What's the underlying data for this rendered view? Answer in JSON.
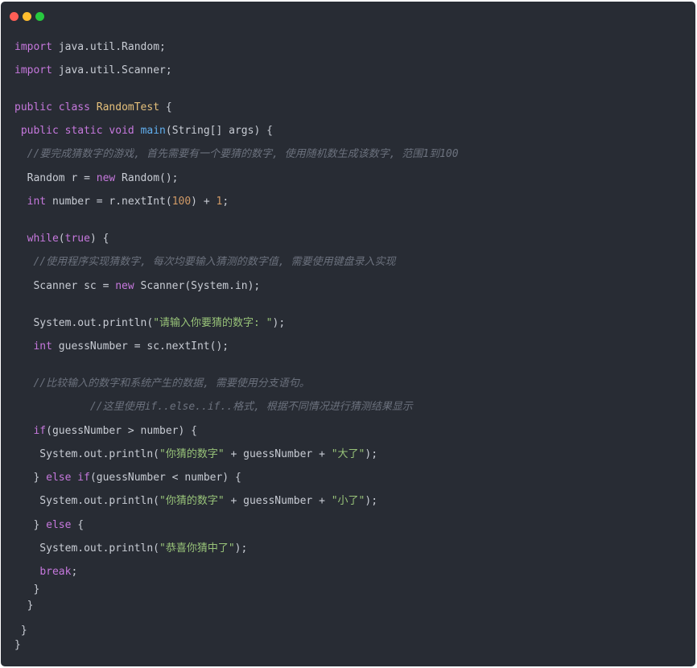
{
  "colors": {
    "background": "#282c34",
    "text": "#c8ccd4",
    "keyword": "#c678dd",
    "class": "#e5c07b",
    "function": "#61afef",
    "string": "#98c379",
    "number": "#d19a66",
    "comment": "#6b717d",
    "close_dot": "#ff5f56",
    "minimize_dot": "#ffbd2e",
    "maximize_dot": "#27c93f"
  },
  "window_controls": [
    {
      "name": "close",
      "color": "#ff5f56"
    },
    {
      "name": "minimize",
      "color": "#ffbd2e"
    },
    {
      "name": "maximize",
      "color": "#27c93f"
    }
  ],
  "code": [
    [
      {
        "t": "import",
        "c": "keyword"
      },
      {
        "t": " java.util.Random;",
        "c": "text"
      }
    ],
    [
      {
        "t": "import",
        "c": "keyword"
      },
      {
        "t": " java.util.Scanner;",
        "c": "text"
      }
    ],
    [
      {
        "t": "public",
        "c": "keyword"
      },
      {
        "t": " ",
        "c": "text"
      },
      {
        "t": "class",
        "c": "keyword"
      },
      {
        "t": " ",
        "c": "text"
      },
      {
        "t": "RandomTest",
        "c": "class"
      },
      {
        "t": " {",
        "c": "text"
      }
    ],
    [
      {
        "t": " ",
        "c": "text"
      },
      {
        "t": "public",
        "c": "keyword"
      },
      {
        "t": " ",
        "c": "text"
      },
      {
        "t": "static",
        "c": "keyword"
      },
      {
        "t": " ",
        "c": "text"
      },
      {
        "t": "void",
        "c": "keyword"
      },
      {
        "t": " ",
        "c": "text"
      },
      {
        "t": "main",
        "c": "function"
      },
      {
        "t": "(String[] args) {",
        "c": "text"
      }
    ],
    [
      {
        "t": "  //要完成猜数字的游戏, 首先需要有一个要猜的数字, 使用随机数生成该数字, 范围1到100",
        "c": "comment"
      }
    ],
    [
      {
        "t": "  Random r = ",
        "c": "text"
      },
      {
        "t": "new",
        "c": "keyword"
      },
      {
        "t": " Random();",
        "c": "text"
      }
    ],
    [
      {
        "t": "  ",
        "c": "text"
      },
      {
        "t": "int",
        "c": "keyword"
      },
      {
        "t": " number = r.nextInt(",
        "c": "text"
      },
      {
        "t": "100",
        "c": "number"
      },
      {
        "t": ") + ",
        "c": "text"
      },
      {
        "t": "1",
        "c": "number"
      },
      {
        "t": ";",
        "c": "text"
      }
    ],
    [
      {
        "t": "  ",
        "c": "text"
      },
      {
        "t": "while",
        "c": "keyword"
      },
      {
        "t": "(",
        "c": "text"
      },
      {
        "t": "true",
        "c": "keyword"
      },
      {
        "t": ") {",
        "c": "text"
      }
    ],
    [
      {
        "t": "   //使用程序实现猜数字, 每次均要输入猜测的数字值, 需要使用键盘录入实现",
        "c": "comment"
      }
    ],
    [
      {
        "t": "   Scanner sc = ",
        "c": "text"
      },
      {
        "t": "new",
        "c": "keyword"
      },
      {
        "t": " Scanner(System.in);",
        "c": "text"
      }
    ],
    [
      {
        "t": "   System.out.println(",
        "c": "text"
      },
      {
        "t": "\"请输入你要猜的数字: \"",
        "c": "string"
      },
      {
        "t": ");",
        "c": "text"
      }
    ],
    [
      {
        "t": "   ",
        "c": "text"
      },
      {
        "t": "int",
        "c": "keyword"
      },
      {
        "t": " guessNumber = sc.nextInt();",
        "c": "text"
      }
    ],
    [
      {
        "t": "   //比较输入的数字和系统产生的数据, 需要使用分支语句。",
        "c": "comment"
      }
    ],
    [
      {
        "t": "            //这里使用if..else..if..格式, 根据不同情况进行猜测结果显示",
        "c": "comment"
      }
    ],
    [
      {
        "t": "   ",
        "c": "text"
      },
      {
        "t": "if",
        "c": "keyword"
      },
      {
        "t": "(guessNumber > number) {",
        "c": "text"
      }
    ],
    [
      {
        "t": "    System.out.println(",
        "c": "text"
      },
      {
        "t": "\"你猜的数字\"",
        "c": "string"
      },
      {
        "t": " + guessNumber + ",
        "c": "text"
      },
      {
        "t": "\"大了\"",
        "c": "string"
      },
      {
        "t": ");",
        "c": "text"
      }
    ],
    [
      {
        "t": "   } ",
        "c": "text"
      },
      {
        "t": "else",
        "c": "keyword"
      },
      {
        "t": " ",
        "c": "text"
      },
      {
        "t": "if",
        "c": "keyword"
      },
      {
        "t": "(guessNumber < number) {",
        "c": "text"
      }
    ],
    [
      {
        "t": "    System.out.println(",
        "c": "text"
      },
      {
        "t": "\"你猜的数字\"",
        "c": "string"
      },
      {
        "t": " + guessNumber + ",
        "c": "text"
      },
      {
        "t": "\"小了\"",
        "c": "string"
      },
      {
        "t": ");",
        "c": "text"
      }
    ],
    [
      {
        "t": "   } ",
        "c": "text"
      },
      {
        "t": "else",
        "c": "keyword"
      },
      {
        "t": " {",
        "c": "text"
      }
    ],
    [
      {
        "t": "    System.out.println(",
        "c": "text"
      },
      {
        "t": "\"恭喜你猜中了\"",
        "c": "string"
      },
      {
        "t": ");",
        "c": "text"
      }
    ],
    [
      {
        "t": "    ",
        "c": "text"
      },
      {
        "t": "break",
        "c": "keyword"
      },
      {
        "t": ";",
        "c": "text"
      }
    ],
    [
      {
        "t": "   }",
        "c": "text"
      }
    ],
    [
      {
        "t": "  }",
        "c": "text"
      }
    ],
    [
      {
        "t": " }",
        "c": "text"
      }
    ],
    [
      {
        "t": "}",
        "c": "text"
      }
    ]
  ]
}
